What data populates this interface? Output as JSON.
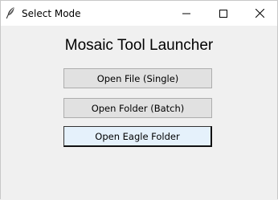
{
  "window": {
    "title": "Select Mode",
    "app_icon": "feather-icon",
    "controls": {
      "minimize_icon": "minimize-icon",
      "maximize_icon": "maximize-icon",
      "close_icon": "close-icon"
    }
  },
  "main": {
    "heading": "Mosaic Tool Launcher",
    "buttons": [
      {
        "label": "Open File (Single)"
      },
      {
        "label": "Open Folder (Batch)"
      },
      {
        "label": "Open Eagle Folder"
      }
    ]
  },
  "colors": {
    "background": "#f0f0f0",
    "button_face": "#e1e1e1",
    "button_hover": "#e5f1fb"
  }
}
